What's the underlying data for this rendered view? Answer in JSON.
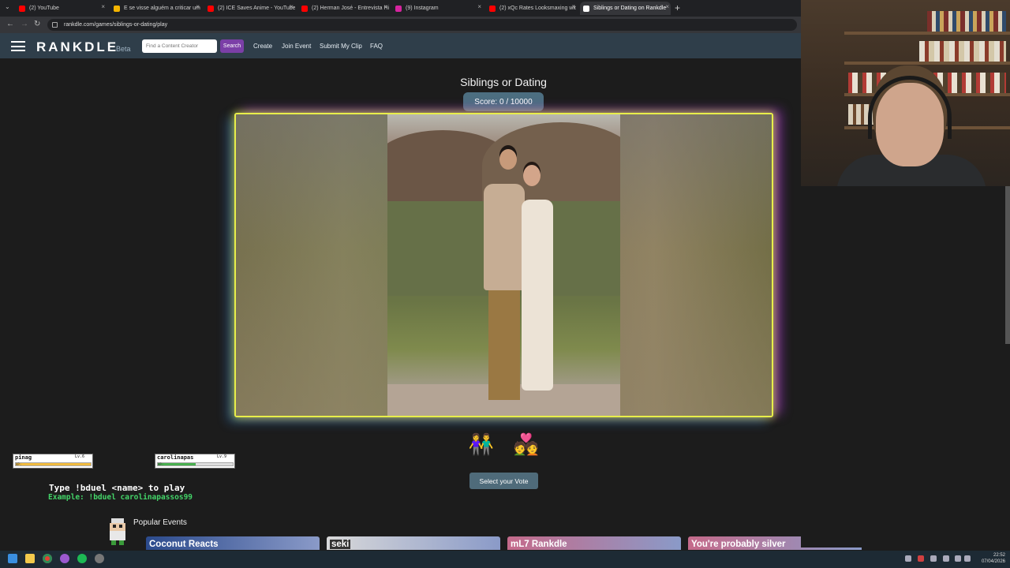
{
  "browser": {
    "tabs": [
      {
        "title": "(2) YouTube",
        "color": "#ff0000"
      },
      {
        "title": "E se visse alguém a criticar um",
        "color": "#f4b400"
      },
      {
        "title": "(2) ICE Saves Anime - YouTube",
        "color": "#ff0000"
      },
      {
        "title": "(2) Herman José - Entrevista Hi",
        "color": "#ff0000"
      },
      {
        "title": "(9) Instagram",
        "color": "#d6249f"
      },
      {
        "title": "(2) xQc Rates Looksmaxing wit",
        "color": "#ff0000"
      },
      {
        "title": "Siblings or Dating on Rankdle",
        "color": "#ffffff"
      }
    ],
    "url": "rankdle.com/games/siblings-or-dating/play"
  },
  "header": {
    "logo": "RANKDLE",
    "beta": "Beta",
    "search_placeholder": "Find a Content Creator",
    "search_button": "Search",
    "nav": [
      "Create",
      "Join Event",
      "Submit My Clip",
      "FAQ"
    ]
  },
  "game": {
    "title": "Siblings or Dating",
    "score": "Score: 0 / 10000",
    "vote_options": [
      {
        "name": "siblings-icon",
        "glyph": "👫"
      },
      {
        "name": "dating-icon",
        "glyph": "💑"
      }
    ],
    "vote_button": "Select your Vote"
  },
  "overlay": {
    "players": [
      {
        "name": "pinag",
        "level": "Lv.6",
        "hp": "HP:",
        "hp_fraction": 1.0,
        "color": "#f0bb3f"
      },
      {
        "name": "carolinapas",
        "level": "Lv.9",
        "hp": "HP:",
        "hp_fraction": 0.5,
        "color": "#49b04f"
      }
    ],
    "instruction": "Type !bduel <name> to play",
    "example": "Example: !bduel carolinapassos99"
  },
  "popular": {
    "heading": "Popular Events",
    "events": [
      {
        "title": "Coconut Reacts",
        "bg": "#2b4a8c"
      },
      {
        "title": "seki",
        "bg": "#d9d9d9"
      },
      {
        "title": "mL7 Rankdle",
        "bg": "#c56a8a"
      },
      {
        "title": "You're probably silver",
        "bg": "#c56a8a"
      }
    ]
  },
  "taskbar": {
    "time": "22:52",
    "date": "07/04/2026"
  }
}
